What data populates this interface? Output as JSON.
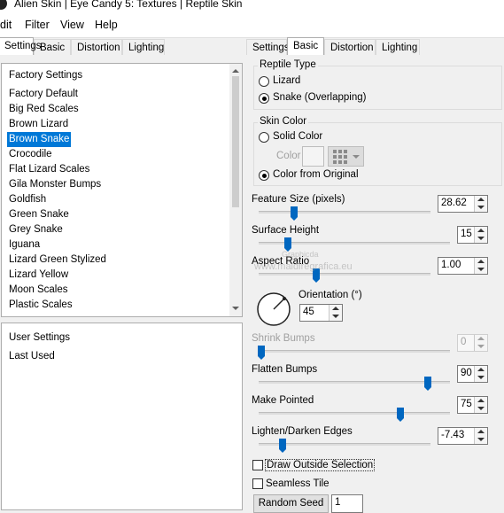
{
  "window": {
    "title": "Alien Skin | Eye Candy 5: Textures | Reptile Skin"
  },
  "menu": {
    "edit": "dit",
    "filter": "Filter",
    "view": "View",
    "help": "Help"
  },
  "left_tabs": [
    "Settings",
    "Basic",
    "Distortion",
    "Lighting"
  ],
  "right_tabs": [
    "Settings",
    "Basic",
    "Distortion",
    "Lighting"
  ],
  "factory": {
    "header": "Factory Settings",
    "items": [
      "Factory Default",
      "Big Red Scales",
      "Brown Lizard",
      "Brown Snake",
      "Crocodile",
      "Flat Lizard Scales",
      "Gila Monster Bumps",
      "Goldfish",
      "Green Snake",
      "Grey Snake",
      "Iguana",
      "Lizard Green Stylized",
      "Lizard Yellow",
      "Moon Scales",
      "Plastic Scales"
    ],
    "selected": "Brown Snake"
  },
  "user": {
    "header": "User Settings",
    "items": [
      "Last Used"
    ]
  },
  "reptile_type": {
    "label": "Reptile Type",
    "options": [
      "Lizard",
      "Snake (Overlapping)"
    ],
    "selected": "Snake (Overlapping)"
  },
  "skin_color": {
    "label": "Skin Color",
    "solid": "Solid Color",
    "color_label": "Color",
    "from_original": "Color from Original",
    "selected": "Color from Original"
  },
  "params": {
    "feature_size": {
      "label": "Feature Size (pixels)",
      "value": "28.62",
      "level": 0.25
    },
    "surface_height": {
      "label": "Surface Height",
      "value": "15",
      "level": 0.15
    },
    "aspect_ratio": {
      "label": "Aspect Ratio",
      "value": "1.00",
      "level": 0.35
    },
    "orientation": {
      "label": "Orientation (°)",
      "value": "45"
    },
    "shrink_bumps": {
      "label": "Shrink Bumps",
      "value": "0",
      "level": 0.0
    },
    "flatten_bumps": {
      "label": "Flatten Bumps",
      "value": "90",
      "level": 0.9
    },
    "make_pointed": {
      "label": "Make Pointed",
      "value": "75",
      "level": 0.75
    },
    "edges": {
      "label": "Lighten/Darken Edges",
      "value": "-7.43",
      "level": 0.17
    }
  },
  "draw_outside": {
    "label": "Draw Outside Selection",
    "checked": false
  },
  "seamless": {
    "label": "Seamless Tile",
    "checked": false
  },
  "random_seed": {
    "label": "Random Seed",
    "value": "1"
  },
  "watermark": {
    "line1": "Graphicda",
    "line2": "www.maldiregrafica.eu"
  }
}
